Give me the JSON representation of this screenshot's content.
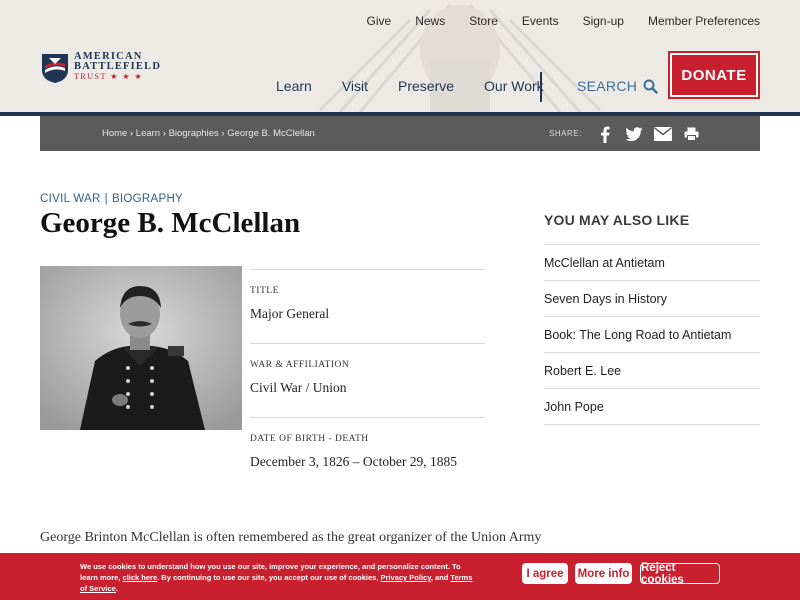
{
  "colors": {
    "navy": "#1f3553",
    "brand_red": "#c8202f",
    "link_blue": "#2f5f8c",
    "crumb_bar": "#5b5b5b",
    "header_bg": "#edeae6"
  },
  "top_nav": [
    "Give",
    "News",
    "Store",
    "Events",
    "Sign-up",
    "Member Preferences"
  ],
  "logo": {
    "line1": "AMERICAN",
    "line2": "BATTLEFIELD",
    "line3": "TRUST ★ ★ ★",
    "icon": "flag-shield-icon"
  },
  "main_nav": [
    "Learn",
    "Visit",
    "Preserve",
    "Our Work"
  ],
  "search_label": "SEARCH",
  "donate_label": "DONATE",
  "breadcrumb": {
    "items": [
      "Home",
      "Learn",
      "Biographies",
      "George B. McClellan"
    ],
    "separator": "›"
  },
  "share": {
    "label": "SHARE:",
    "icons": [
      "facebook-icon",
      "twitter-icon",
      "email-icon",
      "print-icon"
    ]
  },
  "eyebrow": {
    "category": "CIVIL WAR",
    "separator": "|",
    "type": "BIOGRAPHY"
  },
  "title": "George B. McClellan",
  "facts": [
    {
      "label": "TITLE",
      "value": "Major General"
    },
    {
      "label": "WAR & AFFILIATION",
      "value": "Civil War / Union"
    },
    {
      "label": "DATE OF BIRTH - DEATH",
      "value": "December 3, 1826 – October 29, 1885"
    }
  ],
  "sidebar": {
    "heading": "YOU MAY ALSO LIKE",
    "items": [
      "McClellan at Antietam",
      "Seven Days in History",
      "Book: The Long Road to Antietam",
      "Robert E. Lee",
      "John Pope"
    ]
  },
  "intro": "George Brinton McClellan is often remembered as the great organizer of the Union Army",
  "cookie": {
    "text_a": "We use cookies to understand how you use our site, improve your experience, and personalize content. To learn more, ",
    "link_click": "click here",
    "text_b": ". By continuing to use our site, you accept our use of cookies, ",
    "link_privacy": "Privacy Policy",
    "text_c": ", and ",
    "link_terms": "Terms of Service",
    "text_d": ".",
    "agree": "I agree",
    "more_info": "More info",
    "reject": "Reject cookies"
  }
}
